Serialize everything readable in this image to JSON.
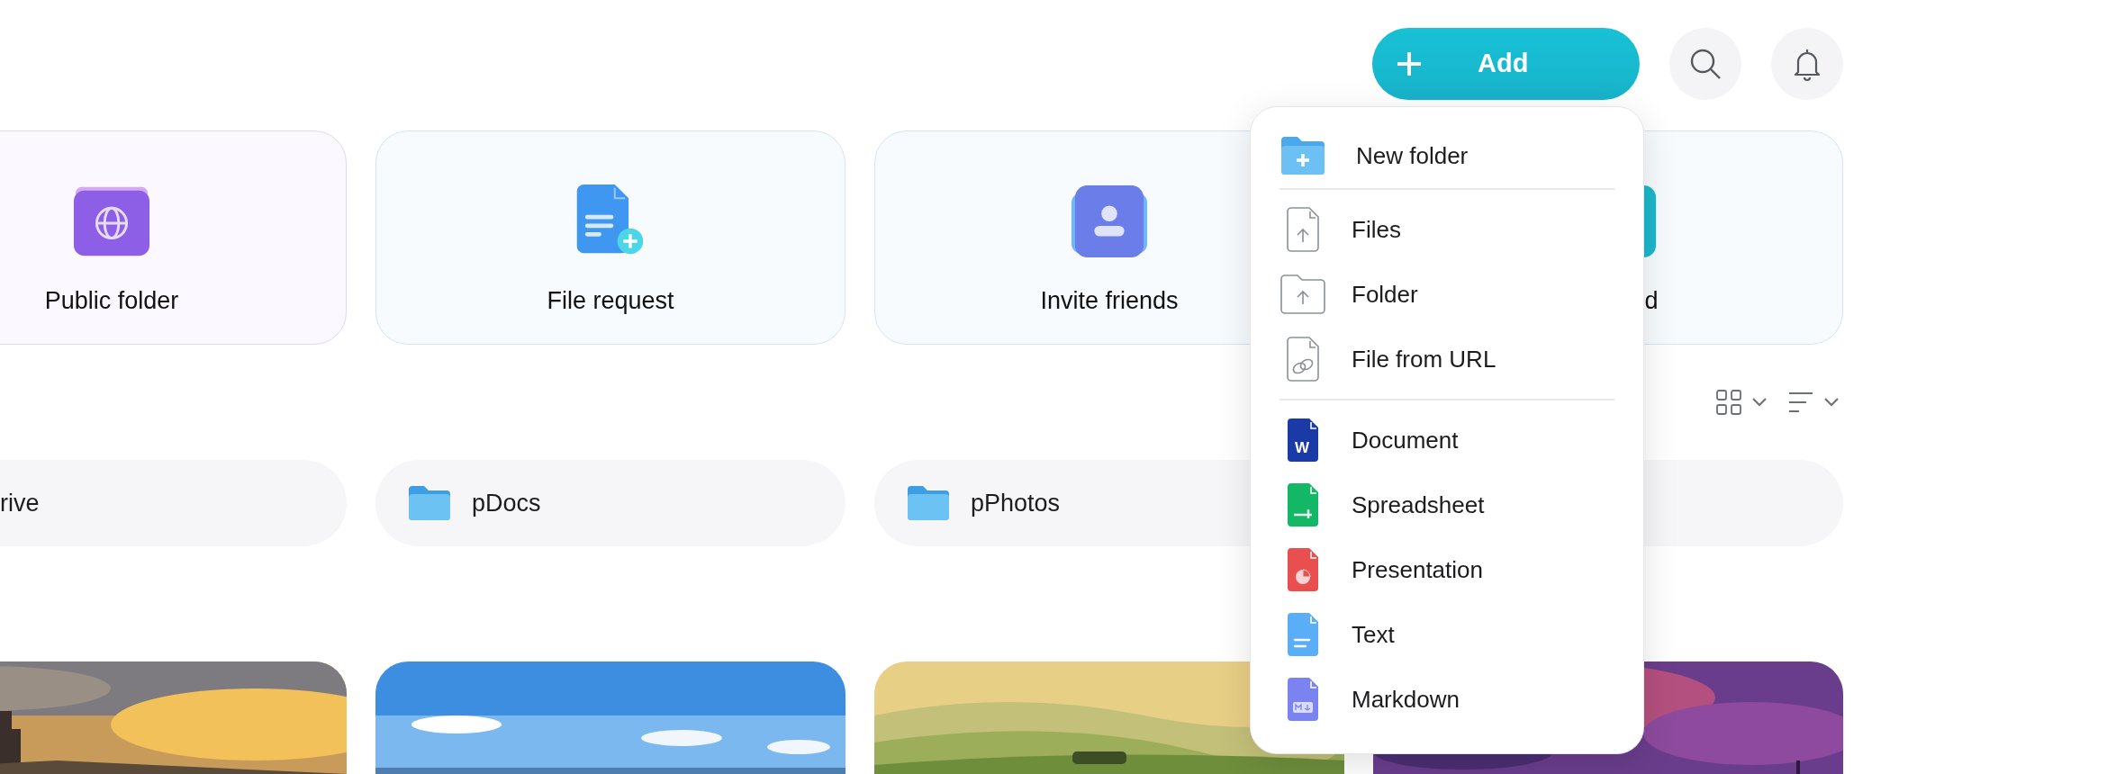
{
  "header": {
    "add_button": "Add"
  },
  "quick_actions": [
    {
      "label": "Public folder",
      "kind": "public"
    },
    {
      "label": "File request",
      "kind": "request"
    },
    {
      "label": "Invite friends",
      "kind": "invite"
    },
    {
      "label": "d",
      "kind": "upload"
    }
  ],
  "folders": [
    {
      "name": "rive",
      "kind": "plain"
    },
    {
      "name": "pDocs",
      "kind": "folder"
    },
    {
      "name": "pPhotos",
      "kind": "folder"
    },
    {
      "kind": "empty"
    }
  ],
  "add_menu": {
    "sections": [
      [
        {
          "label": "New folder",
          "kind": "new-folder"
        }
      ],
      [
        {
          "label": "Files",
          "kind": "upload-file"
        },
        {
          "label": "Folder",
          "kind": "upload-folder"
        },
        {
          "label": "File from URL",
          "kind": "url"
        }
      ],
      [
        {
          "label": "Document",
          "kind": "document",
          "badge": "W"
        },
        {
          "label": "Spreadsheet",
          "kind": "spreadsheet"
        },
        {
          "label": "Presentation",
          "kind": "presentation"
        },
        {
          "label": "Text",
          "kind": "text"
        },
        {
          "label": "Markdown",
          "kind": "markdown"
        }
      ]
    ]
  }
}
